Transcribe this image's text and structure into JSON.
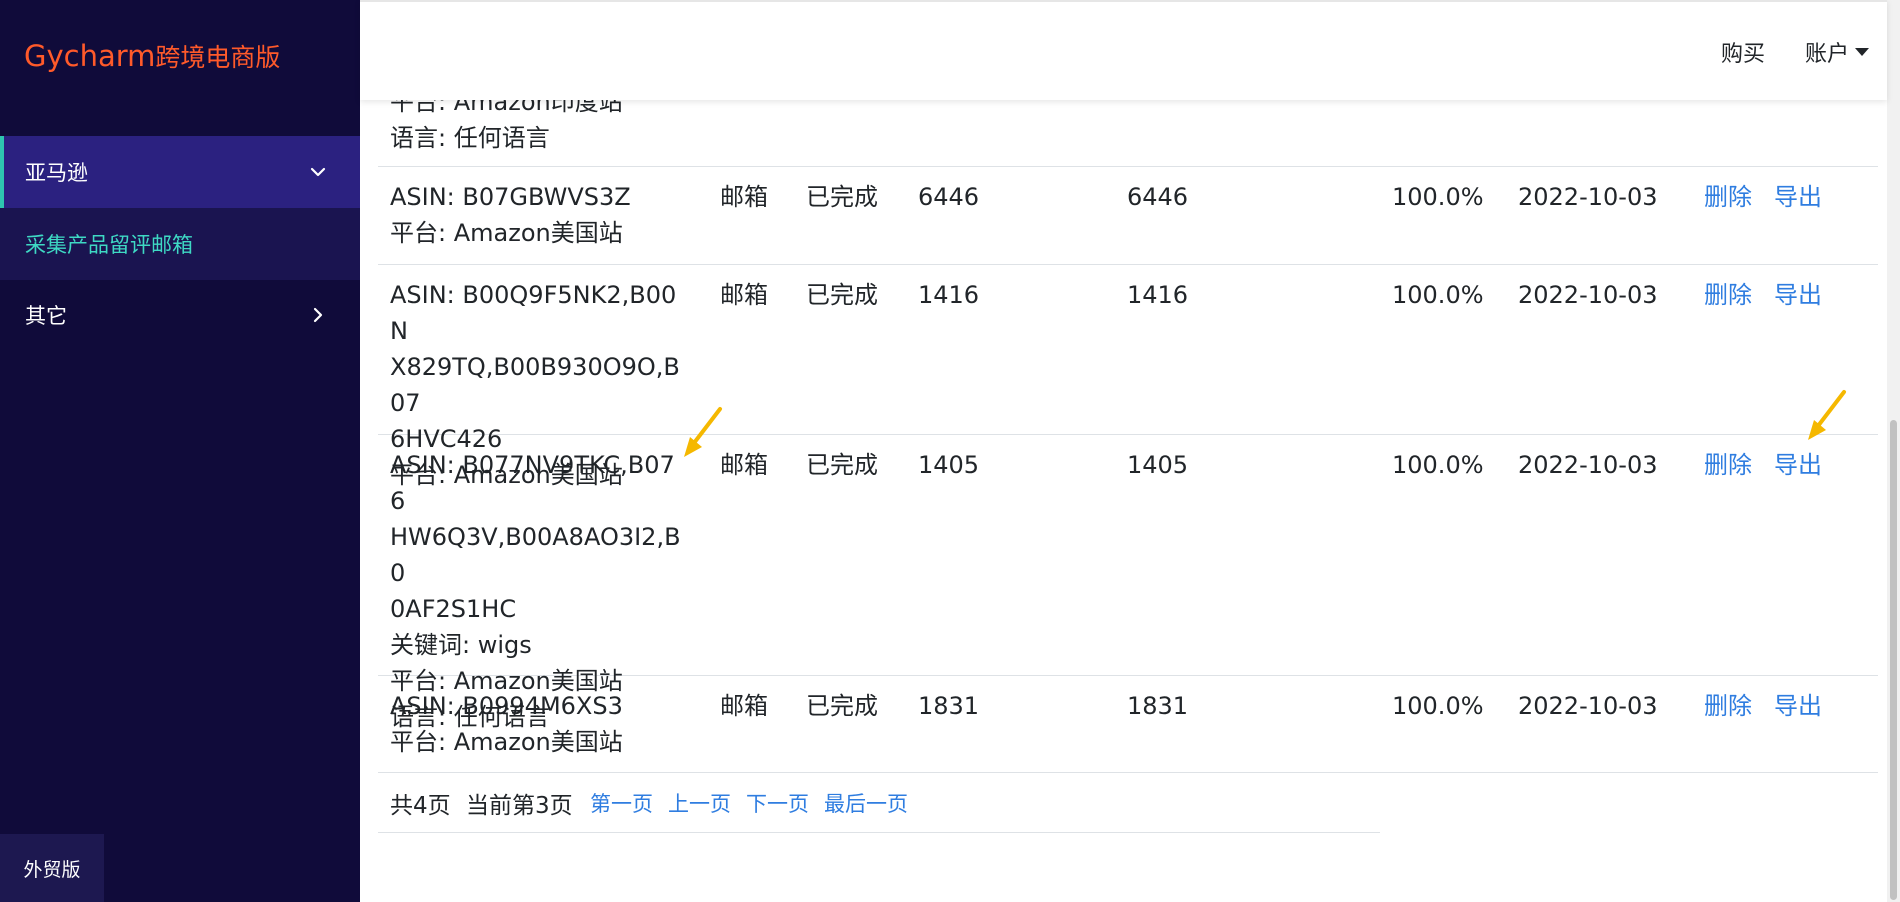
{
  "brand": {
    "name": "Gycharm",
    "edition": "跨境电商版"
  },
  "sidebar": {
    "items": [
      {
        "label": "亚马逊"
      },
      {
        "label": "采集产品留评邮箱"
      },
      {
        "label": "其它"
      }
    ],
    "footer_label": "外贸版"
  },
  "topbar": {
    "buy_label": "购买",
    "account_label": "账户"
  },
  "colors": {
    "sidebar_bg": "#100b3a",
    "brand": "#ff5a2a",
    "active_sub": "#3ed9c4",
    "link": "#2f7de0",
    "arrow": "#f5b800"
  },
  "partial_row": {
    "lines": [
      "平台: Amazon印度站",
      "语言: 任何语言"
    ]
  },
  "rows": [
    {
      "asin_lines": [
        "ASIN: B07GBWVS3Z",
        "平台: Amazon美国站"
      ],
      "type": "邮箱",
      "status": "已完成",
      "total": "6446",
      "done": "6446",
      "percent": "100.0%",
      "date": "2022-10-03",
      "delete": "删除",
      "export": "导出"
    },
    {
      "asin_lines": [
        "ASIN: B00Q9F5NK2,B00N",
        "X829TQ,B00B930O9O,B07",
        "6HVC426",
        "平台: Amazon美国站"
      ],
      "type": "邮箱",
      "status": "已完成",
      "total": "1416",
      "done": "1416",
      "percent": "100.0%",
      "date": "2022-10-03",
      "delete": "删除",
      "export": "导出"
    },
    {
      "asin_lines": [
        "ASIN: B077NV9TKC,B076",
        "HW6Q3V,B00A8AO3I2,B0",
        "0AF2S1HC",
        "关键词: wigs",
        "平台: Amazon美国站",
        "语言: 任何语言"
      ],
      "type": "邮箱",
      "status": "已完成",
      "total": "1405",
      "done": "1405",
      "percent": "100.0%",
      "date": "2022-10-03",
      "delete": "删除",
      "export": "导出"
    },
    {
      "asin_lines": [
        "ASIN: B0994M6XS3",
        "平台: Amazon美国站"
      ],
      "type": "邮箱",
      "status": "已完成",
      "total": "1831",
      "done": "1831",
      "percent": "100.0%",
      "date": "2022-10-03",
      "delete": "删除",
      "export": "导出"
    }
  ],
  "pager": {
    "total": "共4页",
    "current": "当前第3页",
    "first": "第一页",
    "prev": "上一页",
    "next": "下一页",
    "last": "最后一页"
  }
}
